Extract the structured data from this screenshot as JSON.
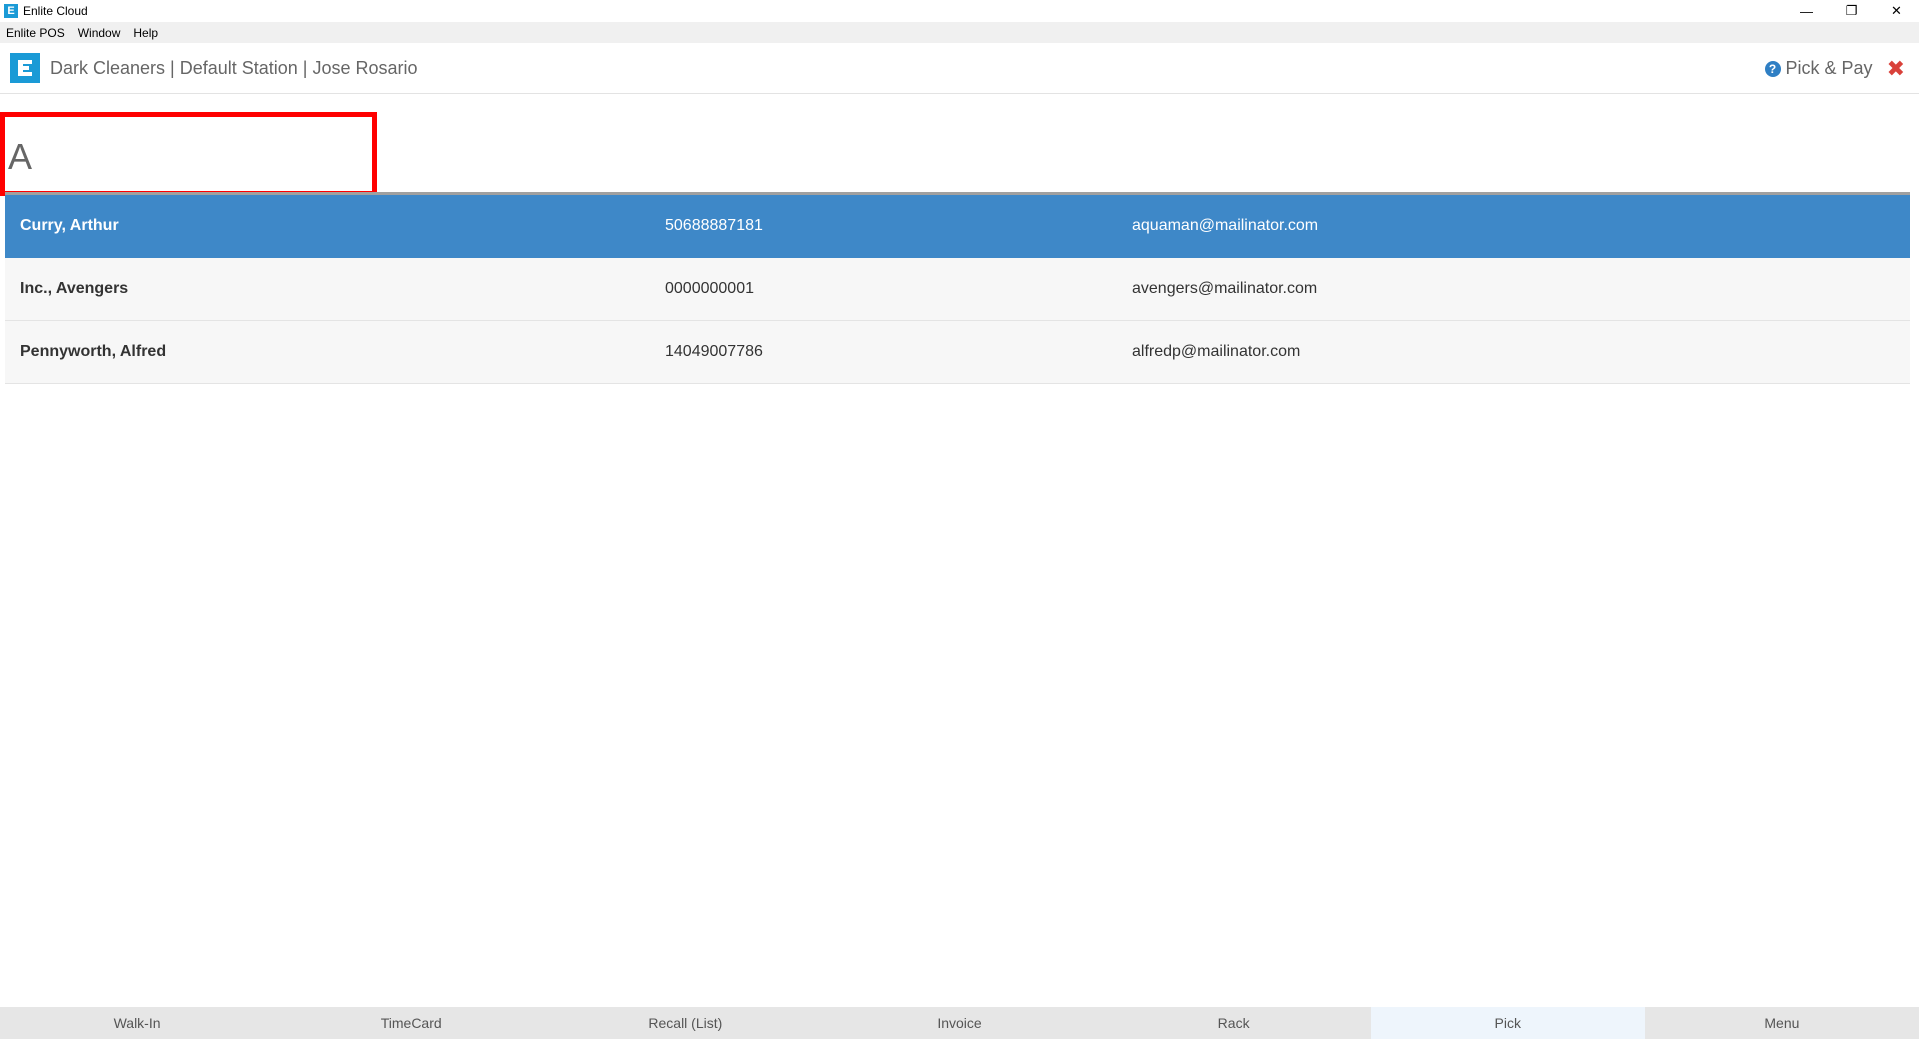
{
  "window": {
    "title": "Enlite Cloud",
    "icon_letter": "E",
    "controls": {
      "minimize": "—",
      "restore": "❐",
      "close": "✕"
    }
  },
  "menubar": {
    "items": [
      "Enlite POS",
      "Window",
      "Help"
    ]
  },
  "header": {
    "breadcrumb": "Dark Cleaners | Default Station | Jose Rosario",
    "page_label": "Pick & Pay",
    "help_glyph": "?",
    "close_glyph": "✖"
  },
  "search": {
    "value": "A",
    "placeholder": ""
  },
  "customers": [
    {
      "name": "Curry, Arthur",
      "phone": "50688887181",
      "email": "aquaman@mailinator.com",
      "selected": true
    },
    {
      "name": "Inc., Avengers",
      "phone": "0000000001",
      "email": "avengers@mailinator.com",
      "selected": false
    },
    {
      "name": "Pennyworth, Alfred",
      "phone": "14049007786",
      "email": "alfredp@mailinator.com",
      "selected": false
    }
  ],
  "bottom_nav": {
    "tabs": [
      "Walk-In",
      "TimeCard",
      "Recall (List)",
      "Invoice",
      "Rack",
      "Pick",
      "Menu"
    ],
    "active": "Pick"
  },
  "colors": {
    "brand": "#1a9ad6",
    "selected_row": "#3e88c8",
    "close_red": "#d9413a",
    "search_highlight": "#ff0000"
  }
}
